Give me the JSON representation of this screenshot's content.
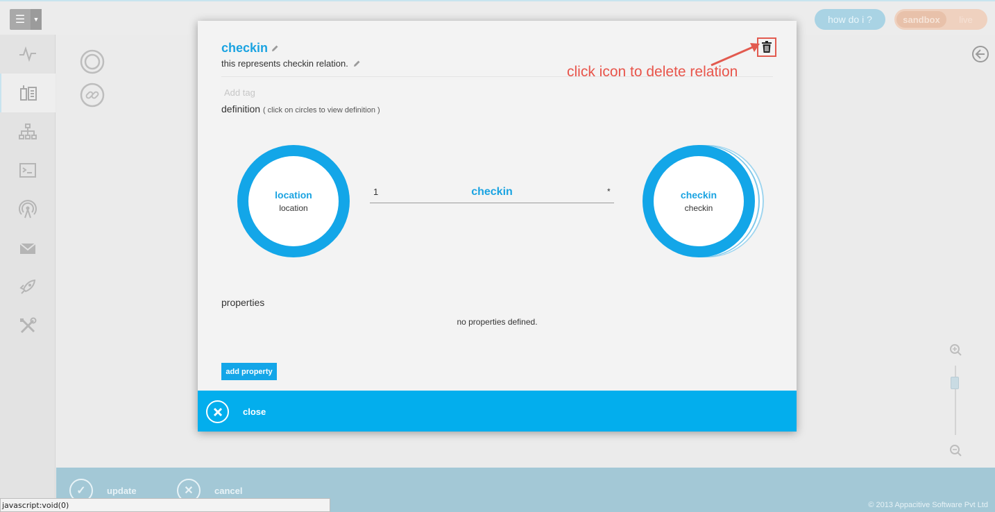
{
  "header": {
    "how_do_i": "how do i ?",
    "env_sandbox": "sandbox",
    "env_live": "live"
  },
  "sidebar": {
    "items": [
      {
        "icon": "activity-icon"
      },
      {
        "icon": "schema-icon",
        "active": true
      },
      {
        "icon": "hierarchy-icon"
      },
      {
        "icon": "console-icon"
      },
      {
        "icon": "broadcast-icon"
      },
      {
        "icon": "mail-icon"
      },
      {
        "icon": "rocket-icon"
      },
      {
        "icon": "tools-icon"
      }
    ]
  },
  "modal": {
    "title": "checkin",
    "description": "this represents checkin relation.",
    "tag_placeholder": "Add tag",
    "definition_label": "definition",
    "definition_hint": "( click on circles to view definition )",
    "annotation": "click icon to delete relation",
    "endpoint_a": {
      "name": "location",
      "type": "location"
    },
    "endpoint_b": {
      "name": "checkin",
      "type": "checkin"
    },
    "relation": {
      "name": "checkin",
      "multiplicity_a": "1",
      "multiplicity_b": "*"
    },
    "properties_label": "properties",
    "no_properties": "no properties defined.",
    "add_property": "add property",
    "close": "close"
  },
  "footer": {
    "update": "update",
    "cancel": "cancel",
    "copyright": "© 2013 Appacitive Software Pvt Ltd"
  },
  "status_bar": "javascript:void(0)",
  "colors": {
    "accent": "#13a6e8",
    "annotation": "#e8544a",
    "footer": "#a3c8d6"
  }
}
